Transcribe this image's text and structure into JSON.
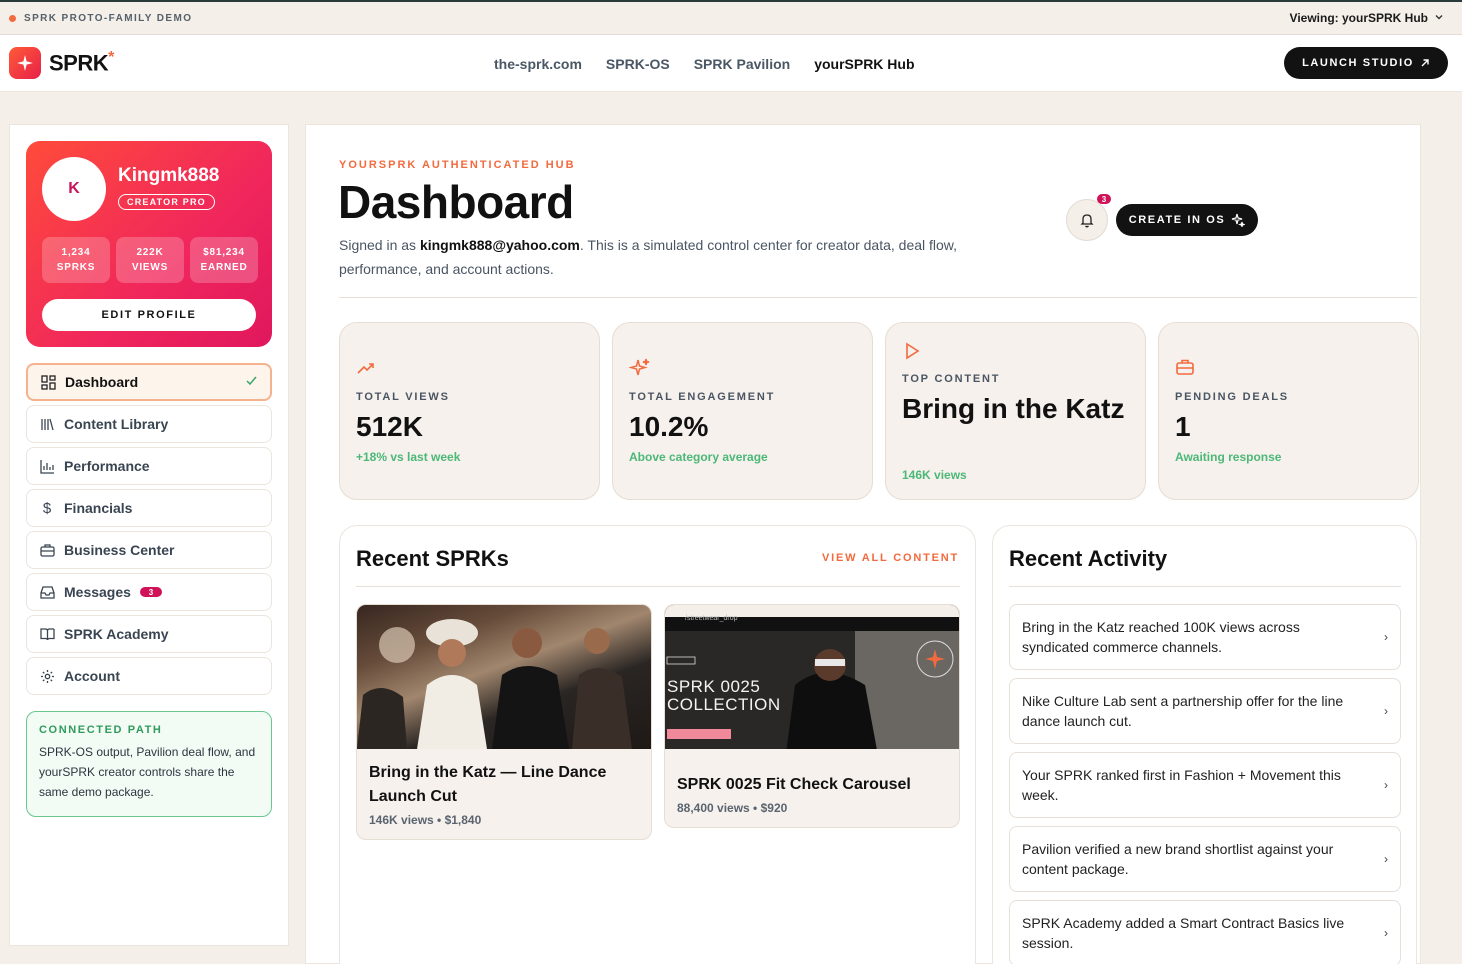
{
  "banner": {
    "left_text": "SPRK PROTO-FAMILY DEMO",
    "right_text": "Viewing: yourSPRK Hub"
  },
  "header": {
    "logo_text": "SPRK",
    "logo_star": "*",
    "nav": [
      "the-sprk.com",
      "SPRK-OS",
      "SPRK Pavilion",
      "yourSPRK Hub"
    ],
    "launch_label": "LAUNCH STUDIO"
  },
  "profile": {
    "avatar_initial": "K",
    "name": "Kingmk888",
    "badge": "CREATOR PRO",
    "stats": [
      {
        "value": "1,234",
        "label": "SPRKS"
      },
      {
        "value": "222K",
        "label": "VIEWS"
      },
      {
        "value": "$81,234",
        "label": "EARNED"
      }
    ],
    "edit_label": "EDIT PROFILE"
  },
  "menu": [
    {
      "label": "Dashboard",
      "icon": "grid-icon"
    },
    {
      "label": "Content Library",
      "icon": "library-icon"
    },
    {
      "label": "Performance",
      "icon": "bar-chart-icon"
    },
    {
      "label": "Financials",
      "icon": "dollar-icon"
    },
    {
      "label": "Business Center",
      "icon": "briefcase-icon"
    },
    {
      "label": "Messages",
      "icon": "inbox-icon",
      "badge": "3"
    },
    {
      "label": "SPRK Academy",
      "icon": "book-icon"
    },
    {
      "label": "Account",
      "icon": "gear-icon"
    }
  ],
  "connected": {
    "title": "CONNECTED PATH",
    "body": "SPRK-OS output, Pavilion deal flow, and yourSPRK creator controls share the same demo package."
  },
  "main": {
    "eyebrow": "YOURSPRK AUTHENTICATED HUB",
    "title": "Dashboard",
    "signed_prefix": "Signed in as ",
    "signed_email": "kingmk888@yahoo.com",
    "signed_suffix": ". This is a simulated control center for creator data, deal flow, performance, and account actions.",
    "bell_badge": "3",
    "create_label": "CREATE IN OS"
  },
  "kpis": [
    {
      "label": "TOTAL VIEWS",
      "value": "512K",
      "sub": "+18% vs last week",
      "icon": "trending-up-icon"
    },
    {
      "label": "TOTAL ENGAGEMENT",
      "value": "10.2%",
      "sub": "Above category average",
      "icon": "sparkle-icon"
    },
    {
      "label": "TOP CONTENT",
      "value": "Bring in the Katz",
      "sub": "146K views",
      "icon": "play-icon"
    },
    {
      "label": "PENDING DEALS",
      "value": "1",
      "sub": "Awaiting response",
      "icon": "briefcase-icon"
    }
  ],
  "recent": {
    "title": "Recent SPRKs",
    "view_all": "VIEW ALL CONTENT",
    "cards": [
      {
        "title": "Bring in the Katz — Line Dance Launch Cut",
        "meta": "146K views • $1,840"
      },
      {
        "title": "SPRK 0025 Fit Check Carousel",
        "meta": "88,400 views • $920",
        "thumb_text_1": "SPRK 0025",
        "thumb_text_2": "COLLECTION",
        "thumb_url": "/streetwear_drop"
      }
    ]
  },
  "activity": {
    "title": "Recent Activity",
    "items": [
      "Bring in the Katz reached 100K views across syndicated commerce channels.",
      "Nike Culture Lab sent a partnership offer for the line dance launch cut.",
      "Your SPRK ranked first in Fashion + Movement this week.",
      "Pavilion verified a new brand shortlist against your content package.",
      "SPRK Academy added a Smart Contract Basics live session."
    ]
  }
}
